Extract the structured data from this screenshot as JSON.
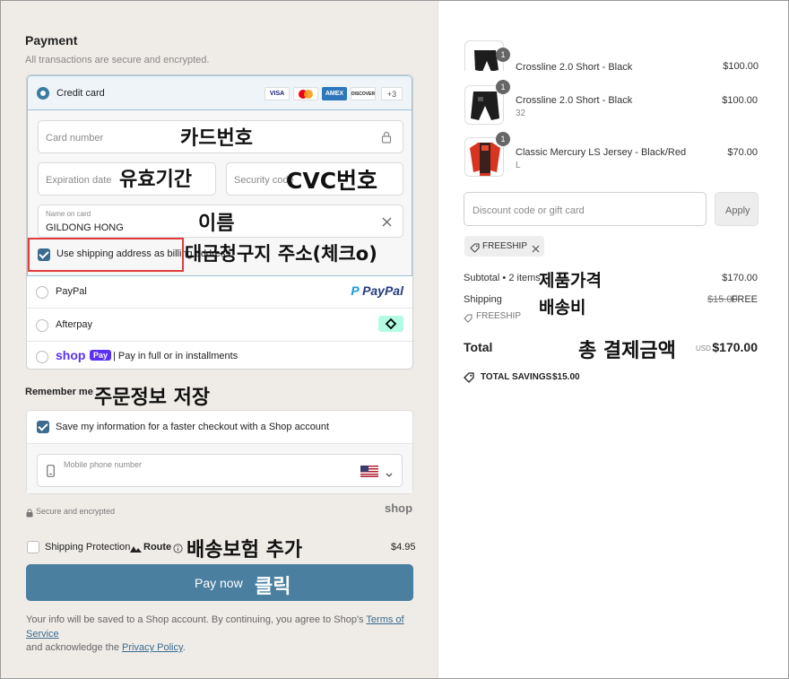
{
  "payment": {
    "title": "Payment",
    "subtitle": "All transactions are secure and encrypted.",
    "credit_card_label": "Credit card",
    "card_brands": [
      "VISA",
      "MC",
      "AMEX",
      "DISCOVER"
    ],
    "more_brands": "+3",
    "card_number_placeholder": "Card number",
    "expiration_placeholder": "Expiration date",
    "security_placeholder": "Security code",
    "name_label": "Name on card",
    "name_value": "GILDONG HONG",
    "billing_label": "Use shipping address as billing address",
    "paypal_label": "PayPal",
    "paypal_logo": "PayPal",
    "afterpay_label": "Afterpay",
    "shoppay_logo": "shop",
    "shoppay_pay": "Pay",
    "shoppay_label": "| Pay in full or in installments"
  },
  "remember": {
    "title": "Remember me",
    "save_label": "Save my information for a faster checkout with a Shop account",
    "phone_placeholder": "Mobile phone number",
    "secure_label": "Secure and encrypted",
    "shop_logo": "shop"
  },
  "shipping_protection": {
    "label": "Shipping Protection",
    "brand": "Route",
    "price": "$4.95"
  },
  "pay_button": "Pay now",
  "footer": {
    "text1": "Your info will be saved to a Shop account. By continuing, you agree to Shop's ",
    "terms": "Terms of Service",
    "text2": "and acknowledge the ",
    "privacy": "Privacy Policy",
    "text3": "."
  },
  "annotations": {
    "card_number": "카드번호",
    "expiration": "유효기간",
    "cvc": "CVC번호",
    "name": "이름",
    "billing": "대금청구지 주소(체크o)",
    "remember": "주문정보 저장",
    "protection": "배송보험 추가",
    "pay": "클릭",
    "subtotal": "제품가격",
    "shipping": "배송비",
    "total": "총 결제금액"
  },
  "cart": {
    "items": [
      {
        "qty": "1",
        "name": "Crossline 2.0 Short - Black",
        "variant": "",
        "price": "$100.00"
      },
      {
        "qty": "1",
        "name": "Crossline 2.0 Short - Black",
        "variant": "32",
        "price": "$100.00"
      },
      {
        "qty": "1",
        "name": "Classic Mercury LS Jersey - Black/Red",
        "variant": "L",
        "price": "$70.00"
      }
    ],
    "discount_placeholder": "Discount code or gift card",
    "apply_label": "Apply",
    "code_tag": "FREESHIP",
    "subtotal_label": "Subtotal • 2 items",
    "subtotal_value": "$170.00",
    "shipping_label": "Shipping",
    "shipping_tag": "FREESHIP",
    "shipping_old": "$15.00",
    "shipping_value": "FREE",
    "total_label": "Total",
    "currency": "USD",
    "total_value": "$170.00",
    "savings_label": "TOTAL SAVINGS",
    "savings_value": "$15.00"
  }
}
